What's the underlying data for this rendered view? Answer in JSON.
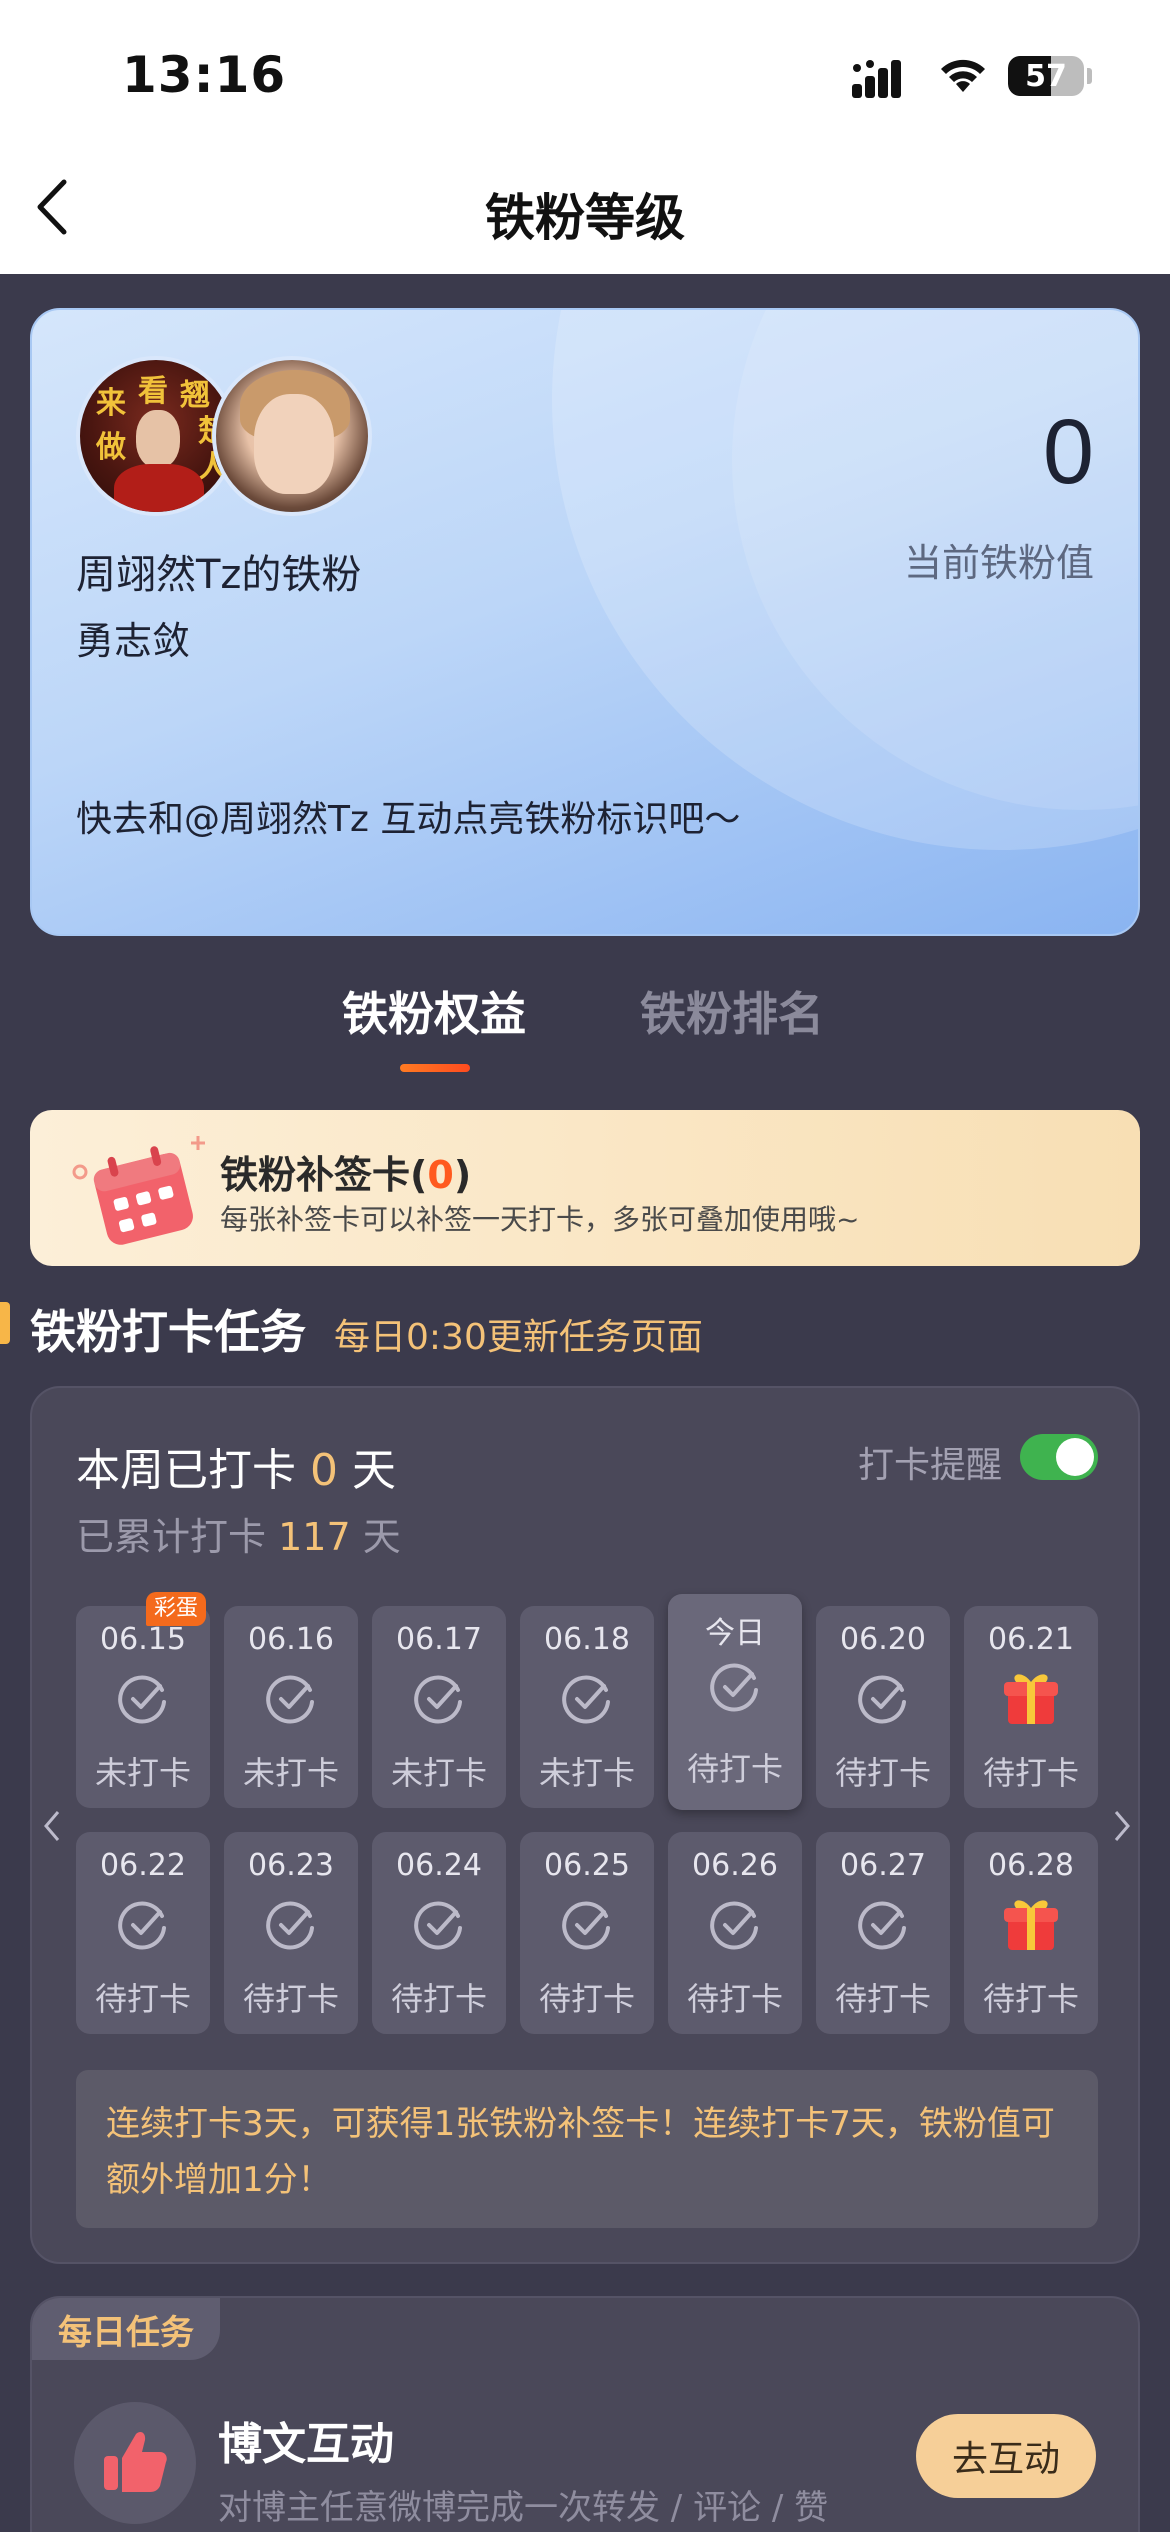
{
  "status_bar": {
    "time": "13:16",
    "battery": "57",
    "battery_level": 0.57
  },
  "nav": {
    "title": "铁粉等级"
  },
  "fan_card": {
    "avatar_text": [
      "来",
      "看",
      "翘",
      "楚",
      "做",
      "人"
    ],
    "name": "周翊然Tz的铁粉",
    "nickname": "勇志敛",
    "value": "0",
    "value_label": "当前铁粉值",
    "tip": "快去和@周翊然Tz 互动点亮铁粉标识吧～"
  },
  "tabs": [
    {
      "label": "铁粉权益",
      "active": true
    },
    {
      "label": "铁粉排名",
      "active": false
    }
  ],
  "makeup_card": {
    "title": "铁粉补签卡(",
    "count": "0",
    "title_end": ")",
    "desc": "每张补签卡可以补签一天打卡，多张可叠加使用哦~"
  },
  "checkin_section": {
    "title": "铁粉打卡任务",
    "subtitle": "每日0:30更新任务页面"
  },
  "checkin": {
    "week_prefix": "本周已打卡",
    "week_count": "0",
    "week_suffix": "天",
    "total_prefix": "已累计打卡",
    "total_count": "117",
    "total_suffix": "天",
    "remind_label": "打卡提醒",
    "remind_on": true,
    "egg_badge": "彩蛋",
    "days": [
      {
        "date": "06.15",
        "status": "未打卡",
        "icon": "check-icon"
      },
      {
        "date": "06.16",
        "status": "未打卡",
        "icon": "check-icon"
      },
      {
        "date": "06.17",
        "status": "未打卡",
        "icon": "check-icon"
      },
      {
        "date": "06.18",
        "status": "未打卡",
        "icon": "check-icon"
      },
      {
        "date": "今日",
        "status": "待打卡",
        "icon": "check-icon"
      },
      {
        "date": "06.20",
        "status": "待打卡",
        "icon": "check-icon"
      },
      {
        "date": "06.21",
        "status": "待打卡",
        "icon": "gift-icon"
      },
      {
        "date": "06.22",
        "status": "待打卡",
        "icon": "check-icon"
      },
      {
        "date": "06.23",
        "status": "待打卡",
        "icon": "check-icon"
      },
      {
        "date": "06.24",
        "status": "待打卡",
        "icon": "check-icon"
      },
      {
        "date": "06.25",
        "status": "待打卡",
        "icon": "check-icon"
      },
      {
        "date": "06.26",
        "status": "待打卡",
        "icon": "check-icon"
      },
      {
        "date": "06.27",
        "status": "待打卡",
        "icon": "check-icon"
      },
      {
        "date": "06.28",
        "status": "待打卡",
        "icon": "gift-icon"
      }
    ],
    "reward_tip": "连续打卡3天，可获得1张铁粉补签卡！连续打卡7天，铁粉值可额外增加1分！"
  },
  "daily_tasks": {
    "badge": "每日任务",
    "items": [
      {
        "title": "博文互动",
        "desc": "对博主任意微博完成一次转发 / 评论 / 赞",
        "button": "去互动",
        "icon": "thumbs-up-icon"
      }
    ]
  },
  "colors": {
    "background": "#3b3a4c",
    "accent": "#f4c278",
    "tab_underline": "#ff5a1f",
    "toggle_on": "#3fb34f",
    "button": "#f6cf98"
  }
}
